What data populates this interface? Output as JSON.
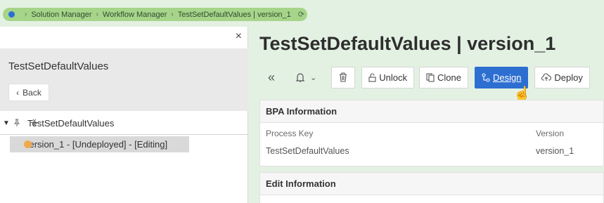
{
  "breadcrumb": {
    "items": [
      "Solution Manager",
      "Workflow Manager",
      "TestSetDefaultValues | version_1"
    ],
    "separator": ">"
  },
  "left_panel": {
    "title": "TestSetDefaultValues",
    "back_label": "Back",
    "close_glyph": "×",
    "tree": {
      "root_label": "TestSetDefaultValues",
      "child_label": "version_1 - [Undeployed] - [Editing]"
    }
  },
  "header": {
    "title": "TestSetDefaultValues | version_1"
  },
  "toolbar": {
    "unlock_label": "Unlock",
    "clone_label": "Clone",
    "design_label": "Design",
    "deploy_label": "Deploy"
  },
  "bpa_card": {
    "title": "BPA Information",
    "columns": [
      "Process Key",
      "Version"
    ],
    "values": [
      "TestSetDefaultValues",
      "version_1"
    ]
  },
  "edit_card": {
    "title": "Edit Information"
  },
  "colors": {
    "primary": "#2c6fd1",
    "breadcrumb_bg": "#a6d58a",
    "status_undeployed": "#f0a94a"
  }
}
